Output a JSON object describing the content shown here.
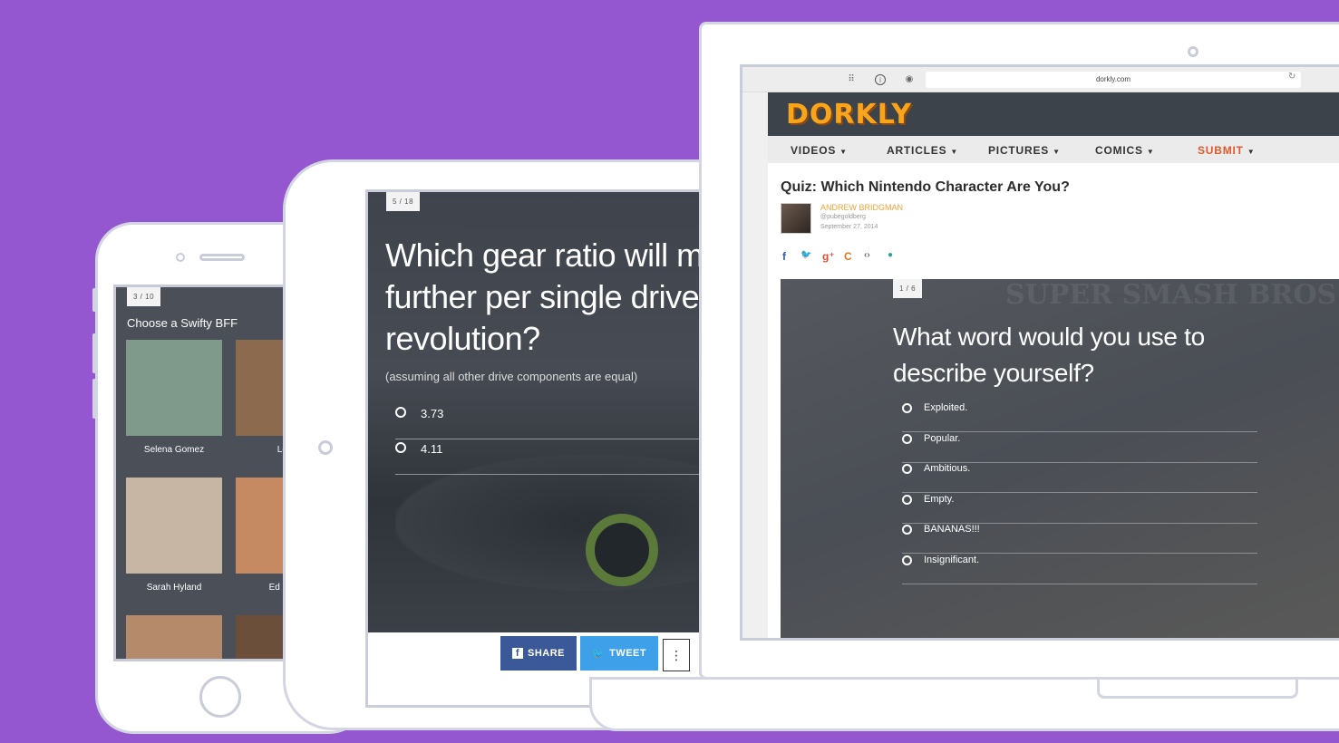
{
  "phone": {
    "counter": "3 / 10",
    "title": "Choose a Swifty BFF",
    "items": [
      {
        "name": "Selena Gomez",
        "color": "#7f9a8a"
      },
      {
        "name": "Lor",
        "color": "#8b6a4e"
      },
      {
        "name": "Sarah Hyland",
        "color": "#c7b6a4"
      },
      {
        "name": "Ed She",
        "color": "#c58a62"
      },
      {
        "name": "",
        "color": "#b48a6a"
      },
      {
        "name": "",
        "color": "#6c4f3a"
      }
    ]
  },
  "tablet": {
    "counter": "5 / 18",
    "question": "Which gear ratio will move a vehicle further per single driveshaft revolution?",
    "subtext": "(assuming all other drive components are equal)",
    "options": [
      "3.73",
      "4.11"
    ],
    "share_label": "SHARE",
    "tweet_label": "TWEET",
    "more_label": "⋮",
    "share_color": "#3b5998",
    "tweet_color": "#3fa0ea"
  },
  "laptop": {
    "url": "dorkly.com",
    "logo": "DORKLY",
    "nav": [
      {
        "label": "VIDEOS"
      },
      {
        "label": "ARTICLES"
      },
      {
        "label": "PICTURES"
      },
      {
        "label": "COMICS"
      },
      {
        "label": "SUBMIT"
      }
    ],
    "article_title": "Quiz: Which Nintendo Character Are You?",
    "author": "ANDREW BRIDGMAN",
    "handle": "@pubegoldberg",
    "date": "September 27, 2014",
    "social_icons": [
      {
        "glyph": "f",
        "name": "facebook-icon",
        "color": "#3b5998"
      },
      {
        "glyph": "🐦",
        "name": "twitter-icon",
        "color": "#3fa0ea"
      },
      {
        "glyph": "g⁺",
        "name": "google-plus-icon",
        "color": "#dd4b39"
      },
      {
        "glyph": "C",
        "name": "cracked-icon",
        "color": "#e8731b"
      },
      {
        "glyph": "‹›",
        "name": "embed-icon",
        "color": "#666666"
      },
      {
        "glyph": "●",
        "name": "comment-icon",
        "color": "#2aa59a"
      }
    ],
    "quiz_counter": "1 / 6",
    "watermark": "SUPER SMASH BROS",
    "question": "What word would you use to describe yourself?",
    "options": [
      "Exploited.",
      "Popular.",
      "Ambitious.",
      "Empty.",
      "BANANAS!!!",
      "Insignificant."
    ]
  }
}
